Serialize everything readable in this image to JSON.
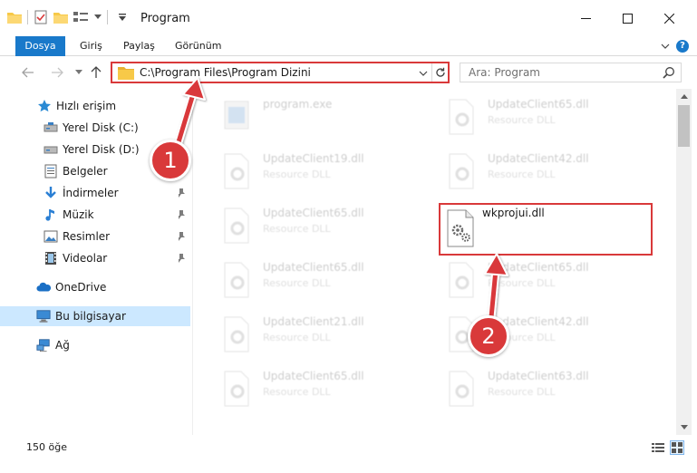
{
  "window": {
    "title": "Program",
    "minimize_glyph": "—",
    "maximize_glyph": "☐",
    "close_glyph": "✕"
  },
  "ribbon": {
    "file_tab": "Dosya",
    "tabs": [
      "Giriş",
      "Paylaş",
      "Görünüm"
    ]
  },
  "address": {
    "path": "C:\\Program Files\\Program Dizini"
  },
  "search": {
    "placeholder": "Ara: Program"
  },
  "sidebar": {
    "items": [
      {
        "label": "Hızlı erişim",
        "icon": "star-icon"
      },
      {
        "label": "Yerel Disk (C:)",
        "icon": "drive-icon"
      },
      {
        "label": "Yerel Disk (D:)",
        "icon": "drive-icon"
      },
      {
        "label": "Belgeler",
        "icon": "documents-icon"
      },
      {
        "label": "İndirmeler",
        "icon": "download-icon"
      },
      {
        "label": "Müzik",
        "icon": "music-icon"
      },
      {
        "label": "Resimler",
        "icon": "pictures-icon"
      },
      {
        "label": "Videolar",
        "icon": "video-icon"
      },
      {
        "label": "OneDrive",
        "icon": "cloud-icon"
      },
      {
        "label": "Bu bilgisayar",
        "icon": "computer-icon"
      },
      {
        "label": "Ağ",
        "icon": "network-icon"
      }
    ]
  },
  "files": [
    {
      "name": "program.exe",
      "type": ""
    },
    {
      "name": "UpdateClient65.dll",
      "type": "Resource DLL"
    },
    {
      "name": "UpdateClient19.dll",
      "type": "Resource DLL"
    },
    {
      "name": "UpdateClient42.dll",
      "type": "Resource DLL"
    },
    {
      "name": "UpdateClient65.dll",
      "type": "Resource DLL"
    },
    {
      "name": "wkprojui.dll",
      "type": ""
    },
    {
      "name": "UpdateClient65.dll",
      "type": "Resource DLL"
    },
    {
      "name": "UpdateClient65.dll",
      "type": "Resource DLL"
    },
    {
      "name": "UpdateClient21.dll",
      "type": "Resource DLL"
    },
    {
      "name": "UpdateClient42.dll",
      "type": "Resource DLL"
    },
    {
      "name": "UpdateClient65.dll",
      "type": "Resource DLL"
    },
    {
      "name": "UpdateClient63.dll",
      "type": "Resource DLL"
    }
  ],
  "status": {
    "count": "150 öğe"
  },
  "annotations": {
    "step1": "1",
    "step2": "2"
  },
  "colors": {
    "accent": "#1979ca",
    "annotation_red": "#d9393a",
    "folder_yellow": "#f7c948",
    "selected_bg": "#cce8ff"
  }
}
